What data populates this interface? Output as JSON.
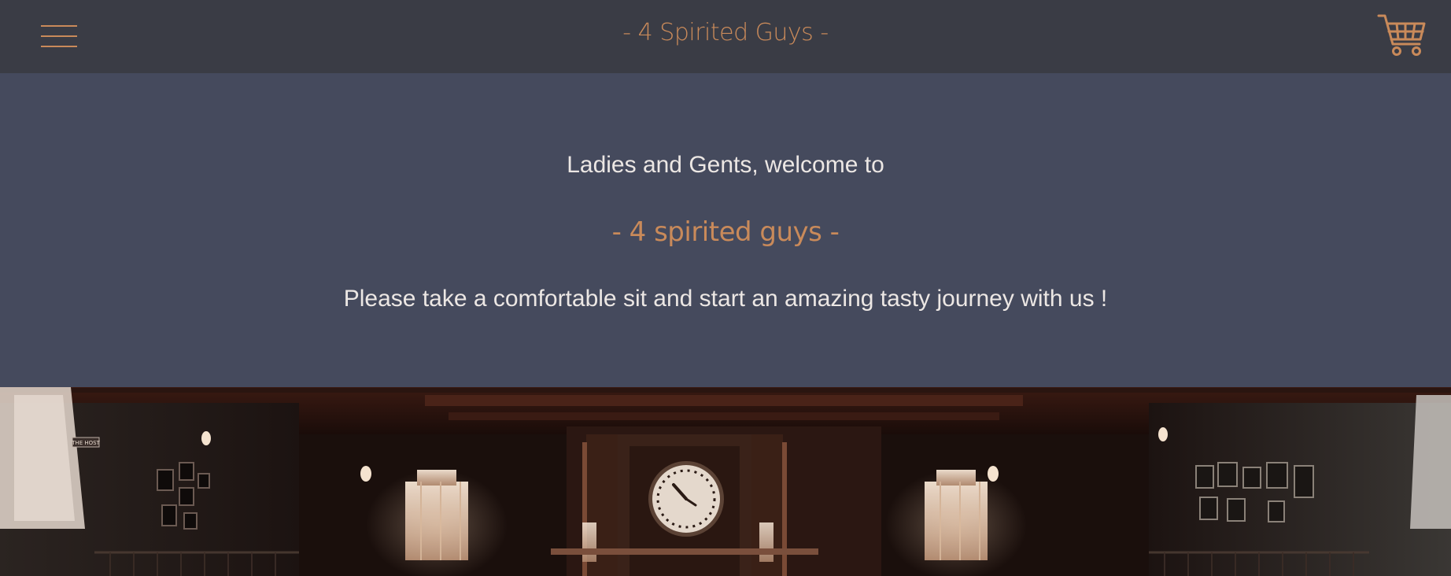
{
  "header": {
    "brand": "- 4 Spirited Guys -",
    "menu_icon": "hamburger-menu-icon",
    "cart_icon": "shopping-cart-icon",
    "accent_color": "#c98a5a",
    "bar_color": "#3a3c45"
  },
  "hero": {
    "welcome": "Ladies and Gents, welcome to",
    "brand": "- 4 spirited guys -",
    "tagline": "Please take a comfortable sit and start an amazing tasty journey with us !",
    "background_color": "#454a5d",
    "text_color": "#ece7e4"
  },
  "photo": {
    "subject": "dark restaurant interior with central wall clock",
    "sign_text": "THE HOST"
  }
}
